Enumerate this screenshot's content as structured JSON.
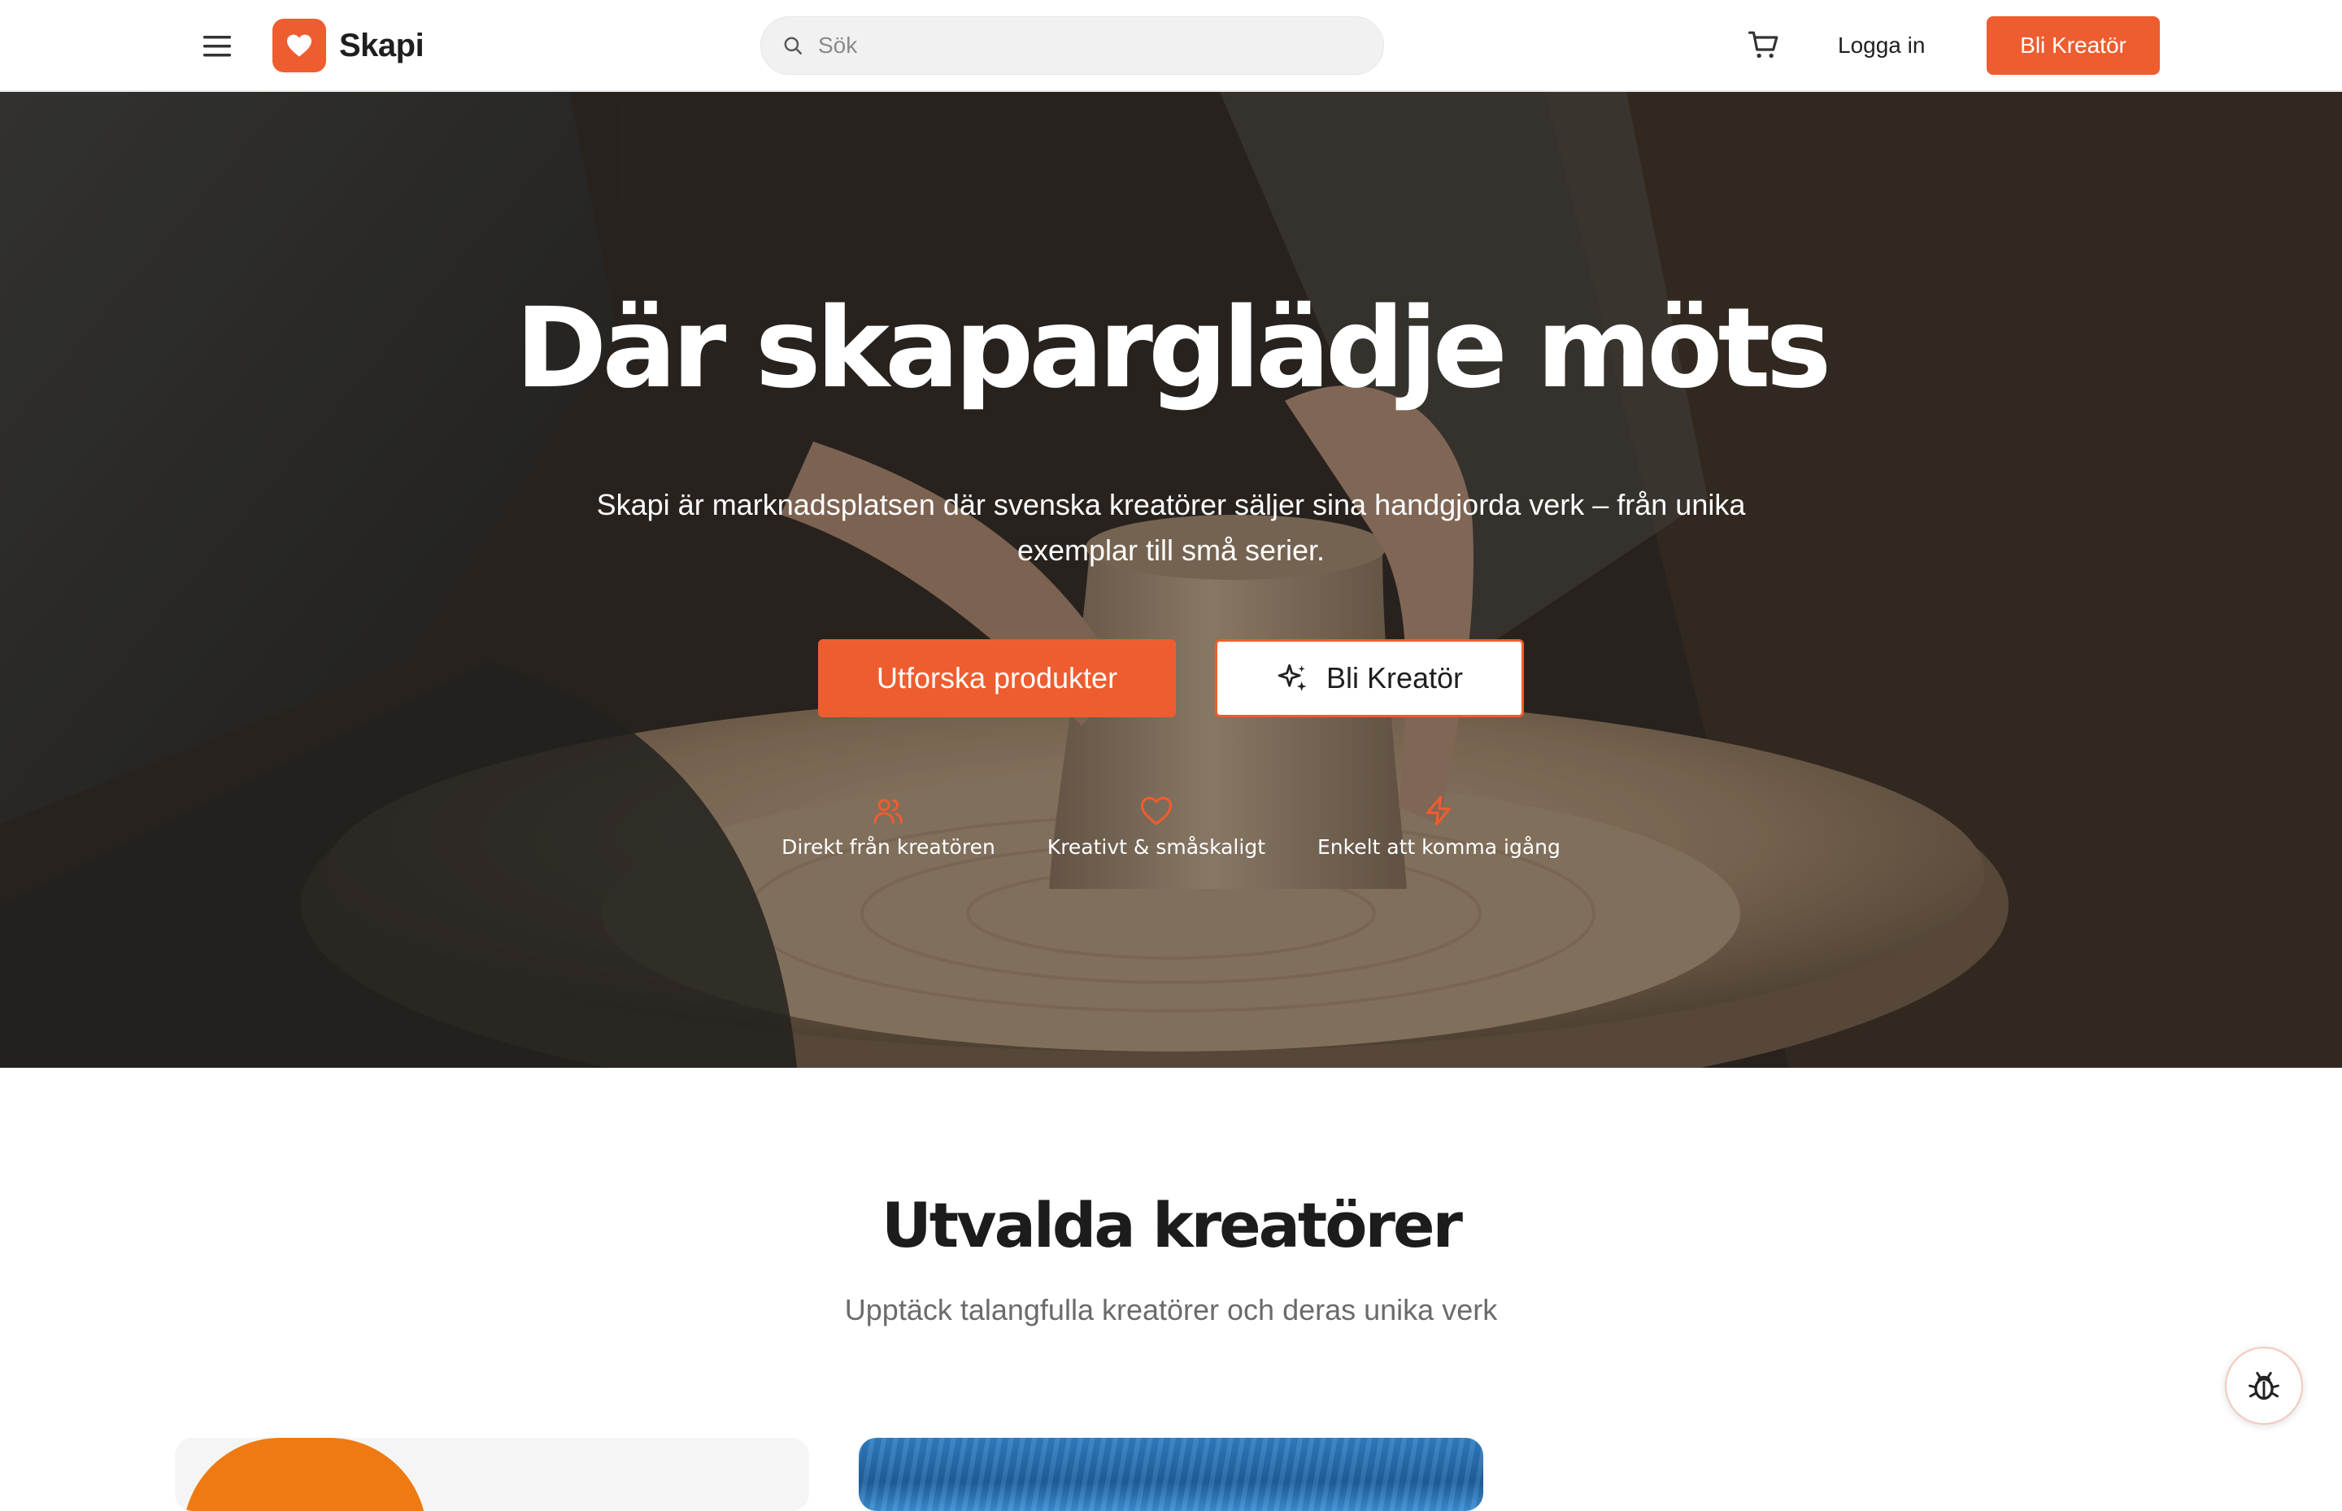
{
  "brand": {
    "name": "Skapi",
    "accent": "#ee5d2f",
    "logo_icon": "heart-icon"
  },
  "header": {
    "search_placeholder": "Sök",
    "login_label": "Logga in",
    "cta_label": "Bli Kreatör"
  },
  "hero": {
    "title": "Där skaparglädje möts",
    "subtitle": "Skapi är marknadsplatsen där svenska kreatörer säljer sina handgjorda verk – från unika exemplar till små serier.",
    "primary_button": "Utforska produkter",
    "secondary_button": "Bli Kreatör",
    "features": [
      {
        "icon": "users-icon",
        "label": "Direkt från kreatören"
      },
      {
        "icon": "heart-icon",
        "label": "Kreativt & småskaligt"
      },
      {
        "icon": "lightning-icon",
        "label": "Enkelt att komma igång"
      }
    ]
  },
  "featured": {
    "title": "Utvalda kreatörer",
    "subtitle": "Upptäck talangfulla kreatörer och deras unika verk"
  }
}
